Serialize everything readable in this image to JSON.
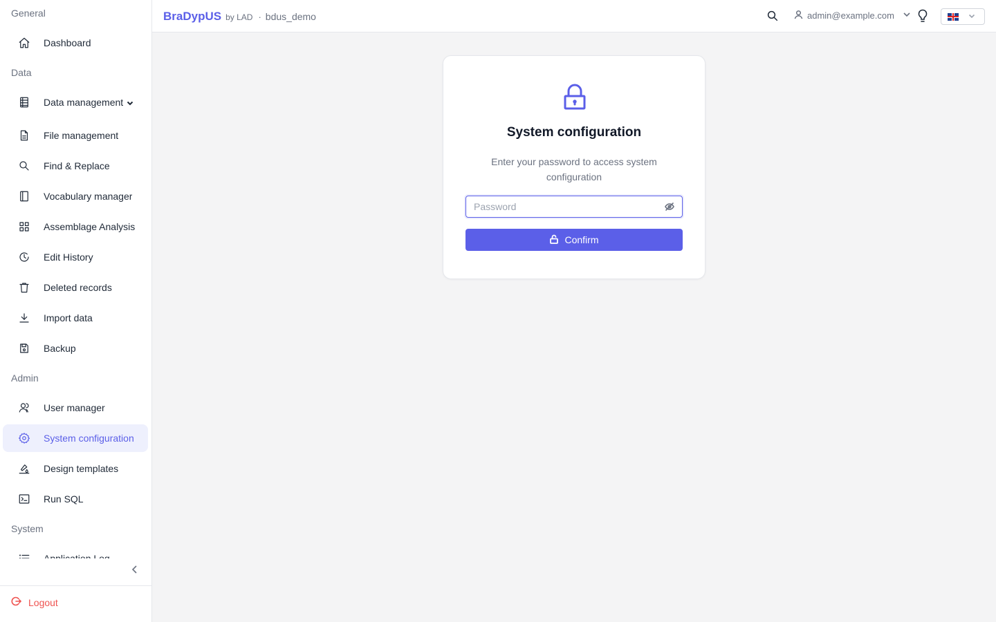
{
  "header": {
    "brand_name": "BraDypUS",
    "brand_by": "by LAD",
    "separator": "·",
    "database": "bdus_demo",
    "user_email": "admin@example.com",
    "language": "en-GB"
  },
  "sidebar": {
    "sections": {
      "general": "General",
      "data": "Data",
      "admin": "Admin",
      "system": "System"
    },
    "items": {
      "dashboard": {
        "label": "Dashboard",
        "icon": "home-icon"
      },
      "data_management": {
        "label": "Data management",
        "icon": "database-icon"
      },
      "file_management": {
        "label": "File management",
        "icon": "file-icon"
      },
      "find_replace": {
        "label": "Find & Replace",
        "icon": "search-icon"
      },
      "vocabulary_manager": {
        "label": "Vocabulary manager",
        "icon": "bookmark-icon"
      },
      "assemblage_analysis": {
        "label": "Assemblage Analysis",
        "icon": "grid-icon"
      },
      "edit_history": {
        "label": "Edit History",
        "icon": "clock-icon"
      },
      "deleted_records": {
        "label": "Deleted records",
        "icon": "trash-icon"
      },
      "import_data": {
        "label": "Import data",
        "icon": "download-icon"
      },
      "backup": {
        "label": "Backup",
        "icon": "save-icon"
      },
      "user_manager": {
        "label": "User manager",
        "icon": "users-icon"
      },
      "system_configuration": {
        "label": "System configuration",
        "icon": "gear-icon",
        "active": true
      },
      "design_templates": {
        "label": "Design templates",
        "icon": "brush-icon"
      },
      "run_sql": {
        "label": "Run SQL",
        "icon": "terminal-icon"
      },
      "application_log": {
        "label": "Application Log",
        "icon": "list-icon"
      }
    },
    "logout": "Logout"
  },
  "auth_card": {
    "title": "System configuration",
    "description": "Enter your password to access system configuration",
    "password_placeholder": "Password",
    "password_value": "",
    "confirm_label": "Confirm"
  },
  "colors": {
    "accent": "#5b5fe8",
    "active_bg": "#eef0fd",
    "logout": "#ef5350",
    "background": "#f4f4f5"
  }
}
